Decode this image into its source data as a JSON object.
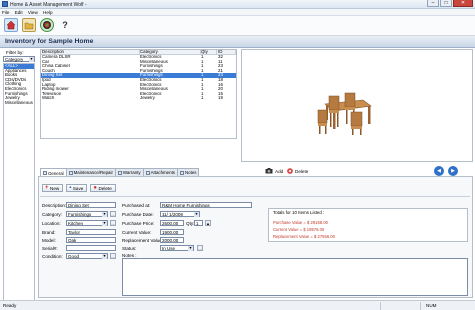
{
  "window": {
    "title": "Home & Asset Management Wolf -",
    "min": "–",
    "max": "□",
    "close": "✕"
  },
  "menu": [
    "File",
    "Edit",
    "View",
    "Help"
  ],
  "toolbar": {
    "icons": [
      "home-inventory-icon",
      "folder-icon",
      "dashboard-icon",
      "key-icon"
    ],
    "key_glyph": "?"
  },
  "header": {
    "title": "Inventory for Sample Home"
  },
  "filter": {
    "label": "Filter by:",
    "selected": "Category",
    "items": [
      "<ALL>",
      "Appliances",
      "Books",
      "CDs/DVDs",
      "Clothing",
      "Electronics",
      "Furnishings",
      "Jewelry",
      "Miscellaneous"
    ],
    "selected_index": 0
  },
  "table": {
    "columns": [
      "Description",
      "Category",
      "Qty",
      "ID"
    ],
    "rows": [
      [
        "Camera DLSR",
        "Electronics",
        "1",
        "32"
      ],
      [
        "Car",
        "Miscellaneous",
        "1",
        "11"
      ],
      [
        "China Cabinet",
        "Furnishings",
        "1",
        "23"
      ],
      [
        "Couch",
        "Furnishings",
        "1",
        "21"
      ],
      [
        "Dining Set",
        "Furnishings",
        "1",
        "24"
      ],
      [
        "Ipod",
        "Electronics",
        "1",
        "18"
      ],
      [
        "Laptop",
        "Electronics",
        "1",
        "16"
      ],
      [
        "Riding mower",
        "Miscellaneous",
        "1",
        "20"
      ],
      [
        "Television",
        "Electronics",
        "1",
        "15"
      ],
      [
        "Watch",
        "Jewelry",
        "1",
        "19"
      ]
    ],
    "selected_row": 4
  },
  "photo": {
    "add_label": "Add",
    "delete_label": "Delete",
    "prev": "◀",
    "next": "▶"
  },
  "tabs": [
    "General",
    "Maintenance/Repair",
    "Warranty",
    "Attachments",
    "Notes"
  ],
  "actions": {
    "new": "New",
    "save": "Save",
    "delete": "Delete",
    "new_glyph": "+",
    "save_glyph": "▪",
    "delete_glyph": "●"
  },
  "form": {
    "description_label": "Description:",
    "description": "Dining Set",
    "category_label": "Category:",
    "category": "Furnishings",
    "location_label": "Location:",
    "location": "Kitchen",
    "brand_label": "Brand:",
    "brand": "Taylor",
    "model_label": "Model:",
    "model": "Oak",
    "serial_label": "Serial#:",
    "serial": "",
    "condition_label": "Condition:",
    "condition": "Good",
    "purchased_at_label": "Purchased at:",
    "purchased_at": "R&M Home Furnishings",
    "purchase_date_label": "Purchase Date:",
    "purchase_date": "11/ 1/2009",
    "purchase_price_label": "Purchase Price:",
    "purchase_price": "2600.00",
    "qty_label": "Qty:",
    "qty": "1",
    "current_value_label": "Current Value:",
    "current_value": "1900.00",
    "replacement_value_label": "Replacement Value:",
    "replacement_value": "2000.00",
    "status_label": "Status:",
    "status": "In Use",
    "notes_label": "Notes :",
    "notes": ""
  },
  "totals": {
    "title": "Totals for 10 Items Listed :",
    "purchase": "Purchase Value = $ 29168.00",
    "current": "Current Value = $ 19576.00",
    "replacement": "Replacement Value = $ 27556.00"
  },
  "status": {
    "text": "Ready",
    "num": "NUM"
  },
  "colors": {
    "accent": "#3a7bd5",
    "header_text": "#1e2d55",
    "totals_text": "#c0392b"
  }
}
